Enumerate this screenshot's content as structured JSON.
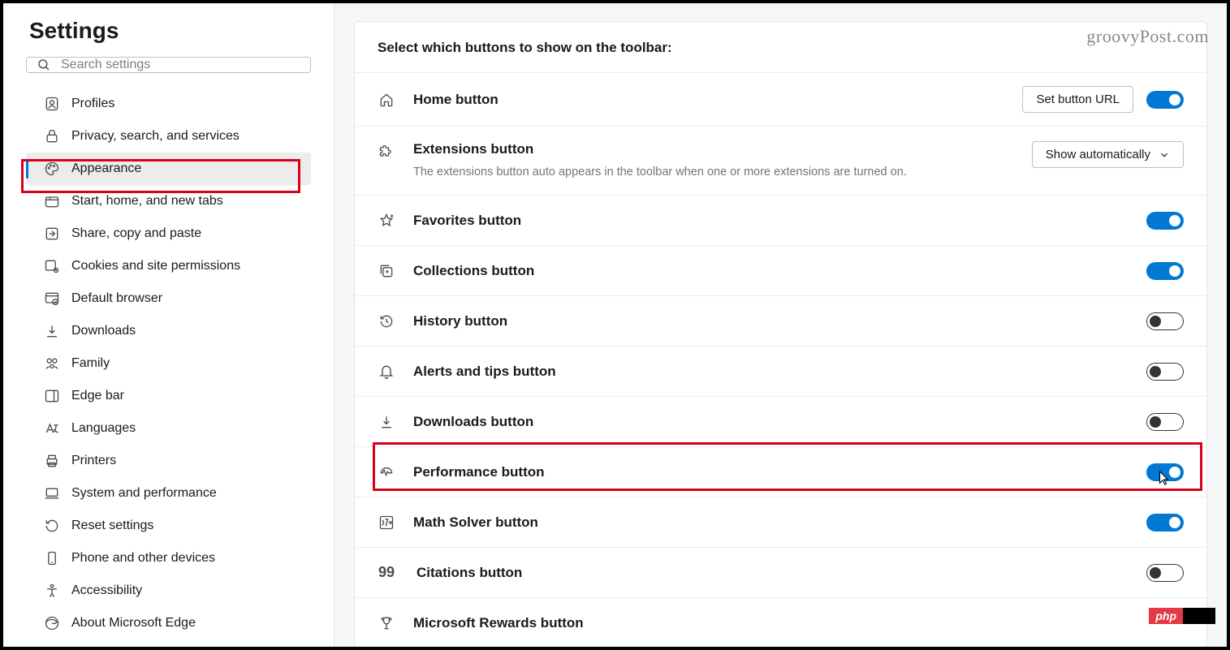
{
  "sidebar": {
    "title": "Settings",
    "search_placeholder": "Search settings",
    "items": [
      {
        "label": "Profiles"
      },
      {
        "label": "Privacy, search, and services"
      },
      {
        "label": "Appearance"
      },
      {
        "label": "Start, home, and new tabs"
      },
      {
        "label": "Share, copy and paste"
      },
      {
        "label": "Cookies and site permissions"
      },
      {
        "label": "Default browser"
      },
      {
        "label": "Downloads"
      },
      {
        "label": "Family"
      },
      {
        "label": "Edge bar"
      },
      {
        "label": "Languages"
      },
      {
        "label": "Printers"
      },
      {
        "label": "System and performance"
      },
      {
        "label": "Reset settings"
      },
      {
        "label": "Phone and other devices"
      },
      {
        "label": "Accessibility"
      },
      {
        "label": "About Microsoft Edge"
      }
    ]
  },
  "main": {
    "section_title": "Select which buttons to show on the toolbar:",
    "rows": {
      "home": {
        "label": "Home button",
        "button": "Set button URL",
        "toggle": true
      },
      "extensions": {
        "label": "Extensions button",
        "desc": "The extensions button auto appears in the toolbar when one or more extensions are turned on.",
        "button": "Show automatically"
      },
      "favorites": {
        "label": "Favorites button",
        "toggle": true
      },
      "collections": {
        "label": "Collections button",
        "toggle": true
      },
      "history": {
        "label": "History button",
        "toggle": false
      },
      "alerts": {
        "label": "Alerts and tips button",
        "toggle": false
      },
      "downloads": {
        "label": "Downloads button",
        "toggle": false
      },
      "performance": {
        "label": "Performance button",
        "toggle": true
      },
      "math": {
        "label": "Math Solver button",
        "toggle": true
      },
      "citations": {
        "label": "Citations button",
        "toggle": false
      },
      "rewards": {
        "label": "Microsoft Rewards button"
      }
    }
  },
  "watermark": "groovyPost.com",
  "php_badge": "php"
}
